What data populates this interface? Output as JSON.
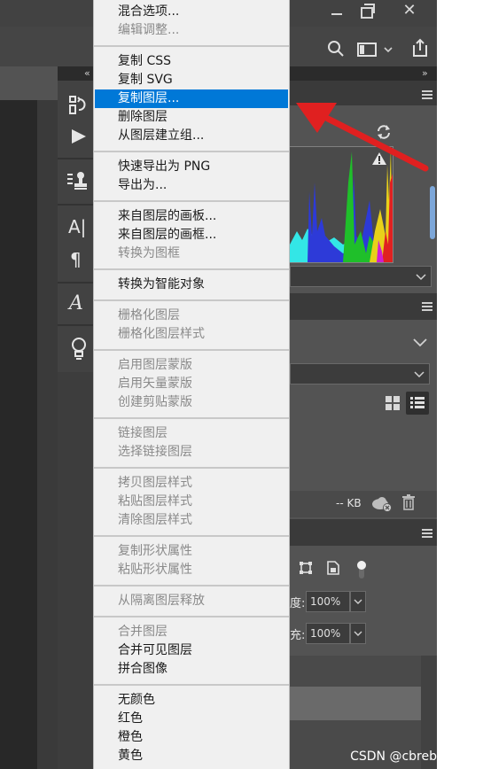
{
  "window": {
    "minimize_icon": "minimize-icon",
    "restore_icon": "restore-icon",
    "close_icon": "close-icon"
  },
  "toolbar": {
    "search_icon": "search-icon",
    "workspace_icon": "workspace-icon",
    "share_icon": "share-icon"
  },
  "panels": {
    "collapse_left": "«",
    "collapse_right": "»",
    "histogram": {
      "warning_icon": "warning-icon",
      "refresh_icon": "refresh-icon"
    },
    "library": {
      "size_label": "-- KB"
    },
    "layers": {
      "opacity_label": "度:",
      "opacity_value": "100%",
      "fill_label": "充:",
      "fill_value": "100%"
    }
  },
  "context_menu": {
    "groups": [
      [
        {
          "label": "混合选项...",
          "disabled": false
        },
        {
          "label": "编辑调整...",
          "disabled": true
        }
      ],
      [
        {
          "label": "复制 CSS",
          "disabled": false
        },
        {
          "label": "复制 SVG",
          "disabled": false
        },
        {
          "label": "复制图层...",
          "disabled": false,
          "selected": true
        },
        {
          "label": "删除图层",
          "disabled": false
        },
        {
          "label": "从图层建立组...",
          "disabled": false
        }
      ],
      [
        {
          "label": "快速导出为 PNG",
          "disabled": false
        },
        {
          "label": "导出为...",
          "disabled": false
        }
      ],
      [
        {
          "label": "来自图层的画板...",
          "disabled": false
        },
        {
          "label": "来自图层的画框...",
          "disabled": false
        },
        {
          "label": "转换为图框",
          "disabled": true
        }
      ],
      [
        {
          "label": "转换为智能对象",
          "disabled": false
        }
      ],
      [
        {
          "label": "栅格化图层",
          "disabled": true
        },
        {
          "label": "栅格化图层样式",
          "disabled": true
        }
      ],
      [
        {
          "label": "启用图层蒙版",
          "disabled": true
        },
        {
          "label": "启用矢量蒙版",
          "disabled": true
        },
        {
          "label": "创建剪贴蒙版",
          "disabled": true
        }
      ],
      [
        {
          "label": "链接图层",
          "disabled": true
        },
        {
          "label": "选择链接图层",
          "disabled": true
        }
      ],
      [
        {
          "label": "拷贝图层样式",
          "disabled": true
        },
        {
          "label": "粘贴图层样式",
          "disabled": true
        },
        {
          "label": "清除图层样式",
          "disabled": true
        }
      ],
      [
        {
          "label": "复制形状属性",
          "disabled": true
        },
        {
          "label": "粘贴形状属性",
          "disabled": true
        }
      ],
      [
        {
          "label": "从隔离图层释放",
          "disabled": true
        }
      ],
      [
        {
          "label": "合并图层",
          "disabled": true
        },
        {
          "label": "合并可见图层",
          "disabled": false
        },
        {
          "label": "拼合图像",
          "disabled": false
        }
      ],
      [
        {
          "label": "无颜色",
          "disabled": false
        },
        {
          "label": "红色",
          "disabled": false
        },
        {
          "label": "橙色",
          "disabled": false
        },
        {
          "label": "黄色",
          "disabled": false
        }
      ]
    ]
  },
  "watermark": "CSDN @cbreb",
  "colors": {
    "highlight": "#0078d7",
    "arrow": "#e02020",
    "menu_bg": "#f0f0f0"
  }
}
